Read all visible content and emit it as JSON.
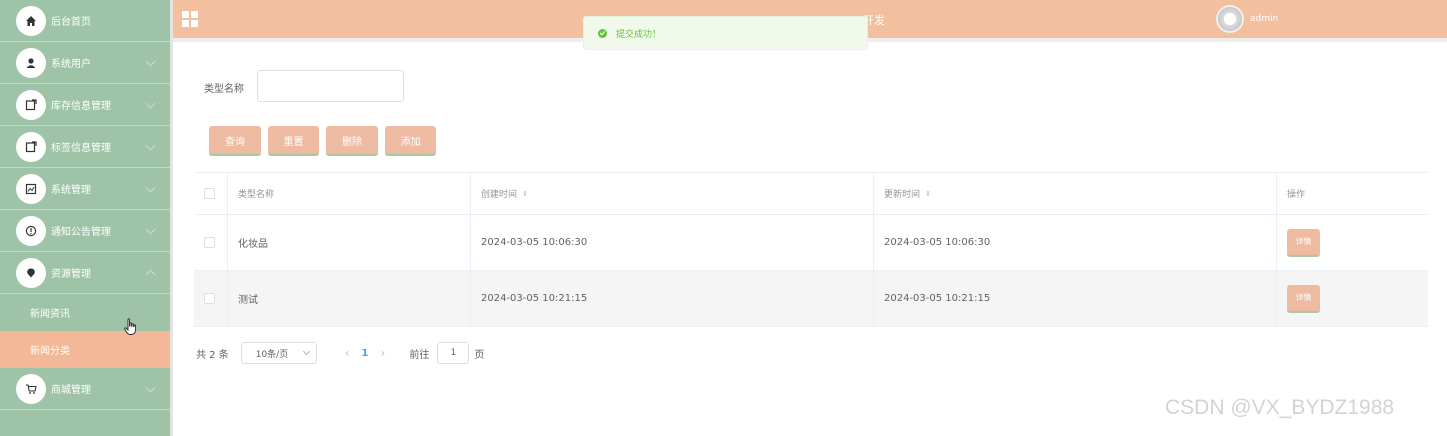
{
  "sidebar": {
    "items": [
      {
        "label": "后台首页",
        "icon": "home-icon"
      },
      {
        "label": "系统用户",
        "icon": "user-icon"
      },
      {
        "label": "库存信息管理",
        "icon": "inventory-icon"
      },
      {
        "label": "标签信息管理",
        "icon": "tag-icon"
      },
      {
        "label": "系统管理",
        "icon": "system-icon"
      },
      {
        "label": "通知公告管理",
        "icon": "notice-icon"
      },
      {
        "label": "资源管理",
        "icon": "resource-icon"
      }
    ],
    "subitems": [
      {
        "label": "新闻资讯",
        "active": false
      },
      {
        "label": "新闻分类",
        "active": true
      }
    ],
    "last_item": {
      "label": "商城管理",
      "icon": "cart-icon"
    },
    "colors": {
      "background": "#9fc3a7",
      "active": "#f2b898"
    }
  },
  "header": {
    "title": "开发",
    "username": "admin",
    "color": "#f2bf9f"
  },
  "toast": {
    "message": "提交成功！",
    "type": "success"
  },
  "search": {
    "label": "类型名称",
    "value": "",
    "placeholder": ""
  },
  "actions": {
    "query": "查询",
    "reset": "重置",
    "delete": "删除",
    "add": "添加"
  },
  "table": {
    "headers": [
      "类型名称",
      "创建时间",
      "更新时间",
      "操作"
    ],
    "rows": [
      {
        "name": "化妆品",
        "created": "2024-03-05 10:06:30",
        "updated": "2024-03-05 10:06:30",
        "action": "详情"
      },
      {
        "name": "测试",
        "created": "2024-03-05 10:21:15",
        "updated": "2024-03-05 10:21:15",
        "action": "详情"
      }
    ]
  },
  "pagination": {
    "total": "共 2 条",
    "page_size": "10条/页",
    "current_page": "1",
    "goto_label": "前往",
    "goto_value": "1",
    "page_suffix": "页"
  },
  "watermark": "CSDN @VX_BYDZ1988"
}
